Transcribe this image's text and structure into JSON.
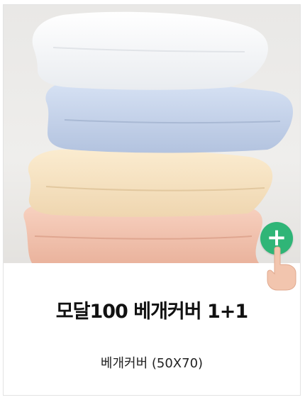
{
  "product": {
    "title": "모달100 베개커버 1+1",
    "subtitle": "베개커버 (50X70)"
  },
  "image": {
    "subject": "stacked-pillows",
    "pillow_colors": [
      "#f6f6f6",
      "#c9d6ec",
      "#f7e4c4",
      "#f4c6b3"
    ]
  },
  "add_button": {
    "icon": "plus-icon",
    "color": "#2fb577"
  },
  "pointer": {
    "icon": "finger-pointer-icon",
    "color": "#f2c5ae"
  }
}
